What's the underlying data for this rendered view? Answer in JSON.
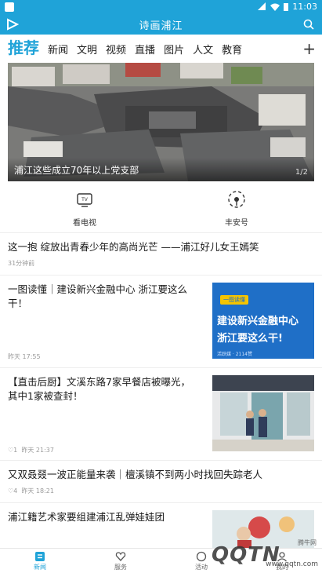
{
  "statusbar": {
    "time": "11:03"
  },
  "appbar": {
    "title": "诗画浦江"
  },
  "tabs": [
    {
      "label": "推荐",
      "active": true
    },
    {
      "label": "新闻"
    },
    {
      "label": "文明"
    },
    {
      "label": "视频"
    },
    {
      "label": "直播"
    },
    {
      "label": "图片"
    },
    {
      "label": "人文"
    },
    {
      "label": "教育"
    }
  ],
  "banner": {
    "caption": "浦江这些成立70年以上党支部",
    "pager": "1/2"
  },
  "quicklinks": [
    {
      "label": "看电视",
      "icon": "tv-icon"
    },
    {
      "label": "丰安号",
      "icon": "broadcast-icon"
    }
  ],
  "news": [
    {
      "title": "这一抱 绽放出青春少年的高尚光芒 ——浦江好儿女王嫣笑",
      "meta": "31分钟前"
    },
    {
      "title": "一图读懂｜建设新兴金融中心 浙江要这么干！",
      "meta": "昨天 17:55",
      "thumb": {
        "tag": "一图读懂",
        "line1": "建设新兴金融中心",
        "line2": "浙江要这么干!",
        "footer": "活跃媒 · 2114赞"
      }
    },
    {
      "title": "【直击后厨】文溪东路7家早餐店被曝光，其中1家被查封！",
      "likes": "1",
      "meta": "昨天 21:37"
    },
    {
      "title": "又双叒叕一波正能量来袭｜檀溪镇不到两小时找回失踪老人",
      "likes": "4",
      "meta": "昨天 18:21"
    },
    {
      "title": "浦江籍艺术家要组建浦江乱弹娃娃团",
      "meta": ""
    }
  ],
  "bottomnav": [
    {
      "label": "新闻",
      "active": true
    },
    {
      "label": "服务"
    },
    {
      "label": "活动"
    },
    {
      "label": "我的"
    }
  ],
  "watermark": {
    "brand": "QQTN",
    "url": "www.qqtn.com",
    "tag": "腾牛网"
  }
}
